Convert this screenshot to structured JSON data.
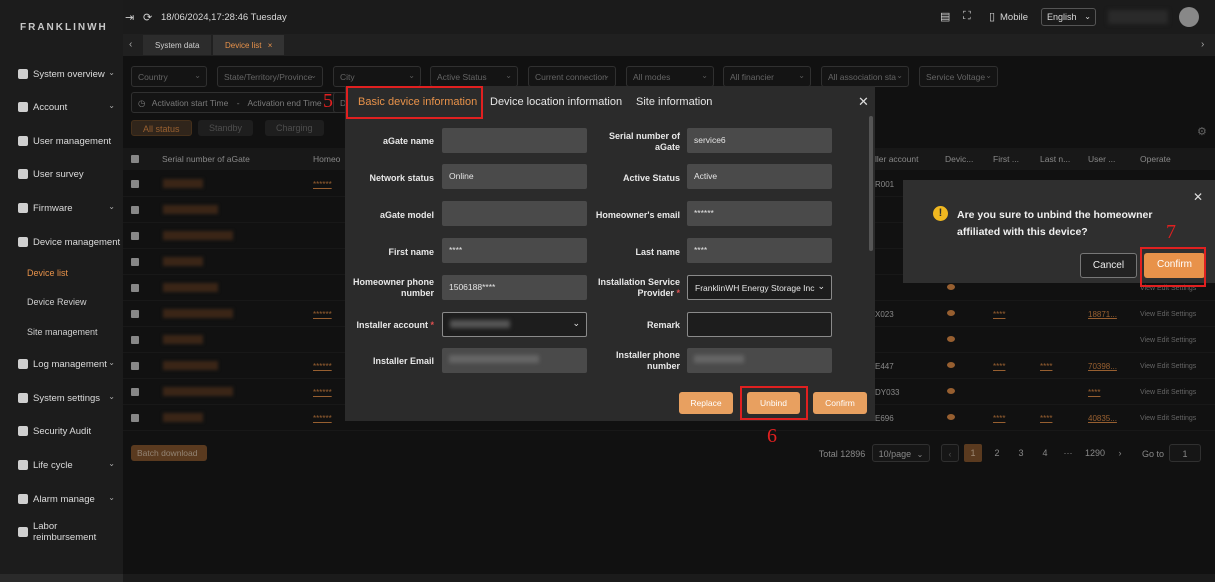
{
  "sidebar": {
    "logo": "FRANKLINWH",
    "items": [
      {
        "label": "System overview",
        "icon": "monitor-icon"
      },
      {
        "label": "Account",
        "icon": "account-icon"
      },
      {
        "label": "User management",
        "icon": "users-icon"
      },
      {
        "label": "User survey",
        "icon": "survey-icon"
      },
      {
        "label": "Firmware",
        "icon": "firmware-icon"
      },
      {
        "label": "Device management",
        "icon": "device-icon"
      },
      {
        "label": "Log management",
        "icon": "log-icon"
      },
      {
        "label": "System settings",
        "icon": "gear-icon"
      },
      {
        "label": "Security Audit",
        "icon": "shield-icon"
      },
      {
        "label": "Life cycle",
        "icon": "lifecycle-icon"
      },
      {
        "label": "Alarm manage",
        "icon": "alarm-icon"
      },
      {
        "label": "Labor reimbursement",
        "icon": "reimburse-icon"
      }
    ],
    "subitems": [
      {
        "label": "Device list"
      },
      {
        "label": "Device Review"
      },
      {
        "label": "Site management"
      }
    ]
  },
  "header": {
    "datetime": "18/06/2024,17:28:46 Tuesday",
    "mobile": "Mobile",
    "language": "English"
  },
  "page_tabs": [
    "System data",
    "Device list"
  ],
  "filters": {
    "row1": [
      "Country",
      "State/Territory/Province",
      "City",
      "Active Status",
      "Current connection",
      "All modes",
      "All financier",
      "All association sta",
      "Service Voltage"
    ],
    "start": "Activation start Time",
    "dash": "-",
    "end": "Activation end Time",
    "d_trunc": "D"
  },
  "status_tabs": [
    "All status",
    "Standby",
    "Charging"
  ],
  "table": {
    "headers": [
      "Serial number of aGate",
      "Homeo",
      "ller account",
      "Devic...",
      "First ...",
      "Last n...",
      "User ...",
      "Operate"
    ],
    "rows": [
      {
        "sn": "********",
        "mask": "******",
        "acct": "R001",
        "first": "",
        "last": "",
        "user": "",
        "ops": ""
      },
      {
        "sn": "********",
        "mask": "",
        "acct": "",
        "first": "",
        "last": "",
        "user": "",
        "ops": ""
      },
      {
        "sn": "********",
        "mask": "",
        "acct": "",
        "first": "",
        "last": "",
        "user": "",
        "ops": ""
      },
      {
        "sn": "********",
        "mask": "",
        "acct": "",
        "first": "",
        "last": "",
        "user": "",
        "ops": ""
      },
      {
        "sn": "********",
        "mask": "",
        "acct": "",
        "first": "",
        "last": "",
        "user": "",
        "ops": "View  Edit  Settings"
      },
      {
        "sn": "********",
        "mask": "******",
        "acct": "X023",
        "first": "****",
        "last": "",
        "user": "18871...",
        "ops": "View  Edit  Settings"
      },
      {
        "sn": "********",
        "mask": "",
        "acct": "",
        "first": "",
        "last": "",
        "user": "",
        "ops": "View  Edit  Settings"
      },
      {
        "sn": "********",
        "mask": "******",
        "acct": "E447",
        "first": "****",
        "last": "****",
        "user": "70398...",
        "ops": "View  Edit  Settings"
      },
      {
        "sn": "********",
        "mask": "******",
        "acct": "DY033",
        "first": "",
        "last": "",
        "user": "****",
        "ops": "View  Edit  Settings"
      },
      {
        "sn": "********",
        "mask": "******",
        "acct": "E696",
        "first": "****",
        "last": "****",
        "user": "40835...",
        "ops": "View  Edit  Settings"
      }
    ]
  },
  "pagination": {
    "batch": "Batch download",
    "total": "Total 12896",
    "per_page": "10/page",
    "pages": [
      "1",
      "2",
      "3",
      "4",
      "···",
      "1290"
    ],
    "goto_label": "Go to",
    "goto_value": "1"
  },
  "modal": {
    "tabs": [
      "Basic device information",
      "Device location information",
      "Site information"
    ],
    "fields": {
      "agate_name": {
        "label": "aGate name",
        "value": ""
      },
      "serial": {
        "label": "Serial number of aGate",
        "value": "service6"
      },
      "network": {
        "label": "Network status",
        "value": "Online"
      },
      "active": {
        "label": "Active Status",
        "value": "Active"
      },
      "model": {
        "label": "aGate model",
        "value": ""
      },
      "email": {
        "label": "Homeowner's email",
        "value": "******"
      },
      "first": {
        "label": "First name",
        "value": "****"
      },
      "last": {
        "label": "Last name",
        "value": "****"
      },
      "phone": {
        "label": "Homeowner phone number",
        "value": "1506188****"
      },
      "provider": {
        "label": "Installation Service Provider",
        "value": "FranklinWH Energy Storage Inc"
      },
      "installer_acct": {
        "label": "Installer account",
        "value": ""
      },
      "remark": {
        "label": "Remark",
        "value": ""
      },
      "installer_email": {
        "label": "Installer Email",
        "value": ""
      },
      "installer_phone": {
        "label": "Installer phone number",
        "value": ""
      }
    },
    "buttons": {
      "replace": "Replace",
      "unbind": "Unbind",
      "confirm": "Confirm"
    }
  },
  "popup": {
    "message": "Are you sure to unbind the homeowner affiliated with this device?",
    "cancel": "Cancel",
    "confirm": "Confirm"
  },
  "annotations": {
    "a5": "5",
    "a6": "6",
    "a7": "7"
  },
  "colors": {
    "accent": "#e8924a",
    "annotation": "#e02020"
  }
}
